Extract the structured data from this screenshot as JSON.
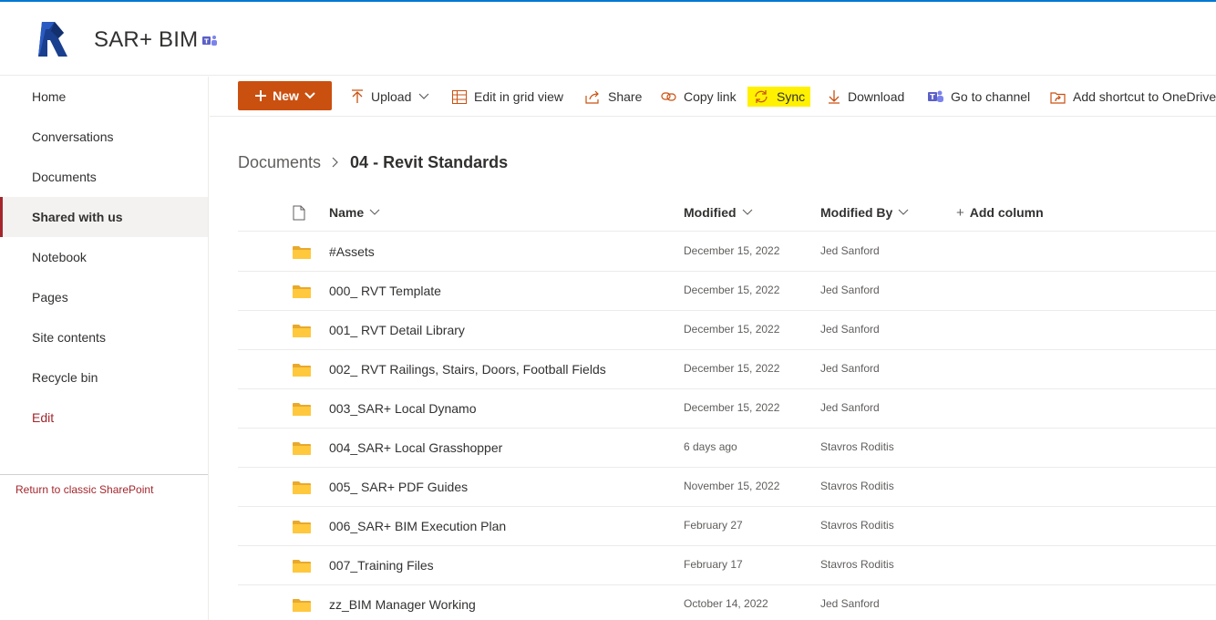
{
  "colors": {
    "accent": "#0078d4",
    "new_button": "#ca5010",
    "sync_highlight": "#fff100",
    "folder": "#ffc83d",
    "nav_selected_bar": "#a4262c"
  },
  "site": {
    "title": "SAR+ BIM",
    "logo_icon": "revit-logo-icon",
    "teams_icon": "teams-icon"
  },
  "nav": {
    "items": [
      {
        "label": "Home"
      },
      {
        "label": "Conversations"
      },
      {
        "label": "Documents"
      },
      {
        "label": "Shared with us",
        "selected": true
      },
      {
        "label": "Notebook"
      },
      {
        "label": "Pages"
      },
      {
        "label": "Site contents"
      },
      {
        "label": "Recycle bin"
      },
      {
        "label": "Edit"
      }
    ],
    "classic": "Return to classic SharePoint"
  },
  "toolbar": {
    "new": "New",
    "upload": "Upload",
    "grid": "Edit in grid view",
    "share": "Share",
    "copy_link": "Copy link",
    "sync": "Sync",
    "download": "Download",
    "channel": "Go to channel",
    "shortcut": "Add shortcut to OneDrive"
  },
  "breadcrumb": {
    "parent": "Documents",
    "current": "04 - Revit Standards"
  },
  "list": {
    "columns": {
      "name": "Name",
      "modified": "Modified",
      "modified_by": "Modified By",
      "add": "Add column"
    },
    "rows": [
      {
        "name": "#Assets",
        "modified": "December 15, 2022",
        "modified_by": "Jed Sanford"
      },
      {
        "name": "000_ RVT Template",
        "modified": "December 15, 2022",
        "modified_by": "Jed Sanford"
      },
      {
        "name": "001_ RVT Detail Library",
        "modified": "December 15, 2022",
        "modified_by": "Jed Sanford"
      },
      {
        "name": "002_ RVT Railings, Stairs, Doors, Football Fields",
        "modified": "December 15, 2022",
        "modified_by": "Jed Sanford"
      },
      {
        "name": "003_SAR+ Local Dynamo",
        "modified": "December 15, 2022",
        "modified_by": "Jed Sanford"
      },
      {
        "name": "004_SAR+ Local Grasshopper",
        "modified": "6 days ago",
        "modified_by": "Stavros Roditis"
      },
      {
        "name": "005_ SAR+ PDF Guides",
        "modified": "November 15, 2022",
        "modified_by": "Stavros Roditis"
      },
      {
        "name": "006_SAR+ BIM Execution Plan",
        "modified": "February 27",
        "modified_by": "Stavros Roditis"
      },
      {
        "name": "007_Training Files",
        "modified": "February 17",
        "modified_by": "Stavros Roditis"
      },
      {
        "name": "zz_BIM Manager Working",
        "modified": "October 14, 2022",
        "modified_by": "Jed Sanford"
      }
    ]
  }
}
